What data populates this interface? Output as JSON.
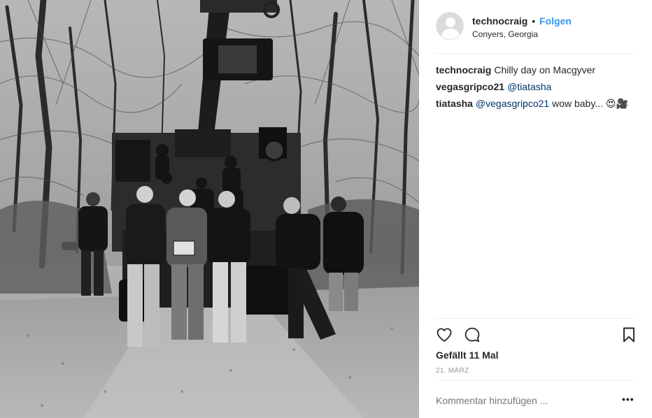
{
  "post": {
    "username": "technocraig",
    "separator": "•",
    "follow_label": "Folgen",
    "location": "Conyers, Georgia",
    "photo_alt": "",
    "comments": [
      {
        "author": "technocraig",
        "text": "Chilly day on Macgyver",
        "mention": "",
        "tail": ""
      },
      {
        "author": "vegasgripco21",
        "text": "",
        "mention": "@tiatasha",
        "tail": ""
      },
      {
        "author": "tiatasha",
        "text": "",
        "mention": "@vegasgripco21",
        "tail": " wow baby... 😍🎥"
      }
    ],
    "likes": "Gefällt 11 Mal",
    "date": "21. MÄRZ",
    "add_comment_placeholder": "Kommentar hinzufügen ...",
    "more_label": "•••"
  },
  "icons": {
    "like": "heart-outline-icon",
    "comment": "speech-bubble-icon",
    "save": "bookmark-outline-icon"
  },
  "colors": {
    "link": "#3897f0",
    "mention": "#003569",
    "text": "#262626",
    "muted": "#999999"
  }
}
